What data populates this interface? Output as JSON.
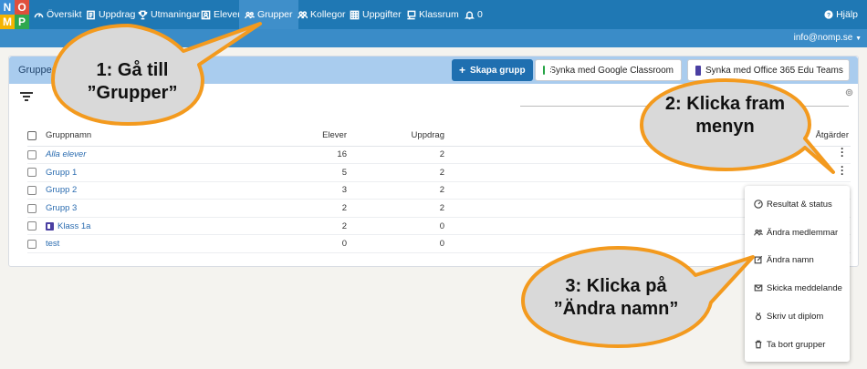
{
  "logo": {
    "letters": [
      "N",
      "O",
      "M",
      "P"
    ]
  },
  "nav": {
    "items": [
      {
        "label": "Översikt",
        "icon": "dashboard-icon"
      },
      {
        "label": "Uppdrag",
        "icon": "assignment-icon"
      },
      {
        "label": "Utmaningar",
        "icon": "trophy-icon"
      },
      {
        "label": "Elever",
        "icon": "student-icon"
      },
      {
        "label": "Grupper",
        "icon": "group-icon",
        "active": true
      },
      {
        "label": "Kollegor",
        "icon": "colleagues-icon"
      },
      {
        "label": "Uppgifter",
        "icon": "grid-icon"
      },
      {
        "label": "Klassrum",
        "icon": "classroom-icon"
      },
      {
        "label": "0",
        "icon": "bell-icon"
      }
    ],
    "help_label": "Hjälp",
    "user_email": "info@nomp.se"
  },
  "panel": {
    "title": "Grupper",
    "create_button": "Skapa grupp",
    "sync_google": "Synka med Google Classroom",
    "sync_office": "Synka med Office 365 Edu Teams"
  },
  "table": {
    "headers": {
      "name": "Gruppnamn",
      "students": "Elever",
      "assignments": "Uppdrag",
      "actions": "Åtgärder"
    },
    "rows": [
      {
        "name": "Alla elever",
        "students": "16",
        "assignments": "2",
        "italic": true
      },
      {
        "name": "Grupp 1",
        "students": "5",
        "assignments": "2"
      },
      {
        "name": "Grupp 2",
        "students": "3",
        "assignments": "2"
      },
      {
        "name": "Grupp 3",
        "students": "2",
        "assignments": "2"
      },
      {
        "name": "Klass 1a",
        "students": "2",
        "assignments": "0",
        "teams": true
      },
      {
        "name": "test",
        "students": "0",
        "assignments": "0"
      }
    ]
  },
  "menu": {
    "items": [
      {
        "label": "Resultat & status",
        "icon": "gauge-icon"
      },
      {
        "label": "Ändra medlemmar",
        "icon": "group-icon"
      },
      {
        "label": "Ändra namn",
        "icon": "edit-icon"
      },
      {
        "label": "Skicka meddelande",
        "icon": "envelope-icon"
      },
      {
        "label": "Skriv ut diplom",
        "icon": "medal-icon"
      },
      {
        "label": "Ta bort grupper",
        "icon": "trash-icon"
      }
    ]
  },
  "callouts": {
    "step1": [
      "1: Gå till",
      "”Grupper”"
    ],
    "step2": [
      "2: Klicka fram",
      "menyn"
    ],
    "step3": [
      "3: Klicka på",
      "”Ändra namn”"
    ]
  },
  "colors": {
    "nav": "#1f78b4",
    "panel_header": "#a9ccee",
    "callout_fill": "#d9d9d9",
    "callout_border": "#f39a1e",
    "link": "#2b6cb0"
  }
}
